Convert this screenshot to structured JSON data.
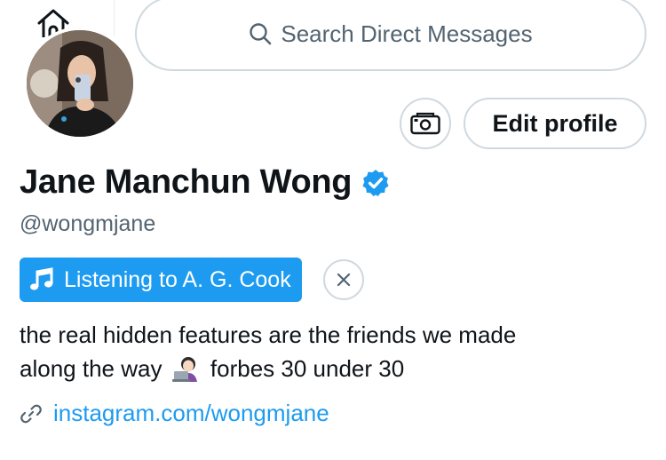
{
  "search": {
    "placeholder": "Search Direct Messages",
    "icon": "search-icon"
  },
  "actions": {
    "camera_icon": "camera-money-icon",
    "edit_profile_label": "Edit profile"
  },
  "profile": {
    "name": "Jane Manchun Wong",
    "verified_icon": "verified-badge-icon",
    "handle": "@wongmjane",
    "listening": {
      "icon": "music-note-icon",
      "label": "Listening to A. G. Cook"
    },
    "bio_line1": "the real hidden features are the friends we made",
    "bio_line2_before": "along the way",
    "bio_emoji": "woman-technologist-emoji",
    "bio_line2_after": "forbes 30 under 30",
    "link_icon": "link-icon",
    "link": "instagram.com/wongmjane"
  },
  "colors": {
    "accent": "#1d9bf0",
    "border": "#cfd9de",
    "muted": "#536471",
    "text": "#0f1419"
  }
}
